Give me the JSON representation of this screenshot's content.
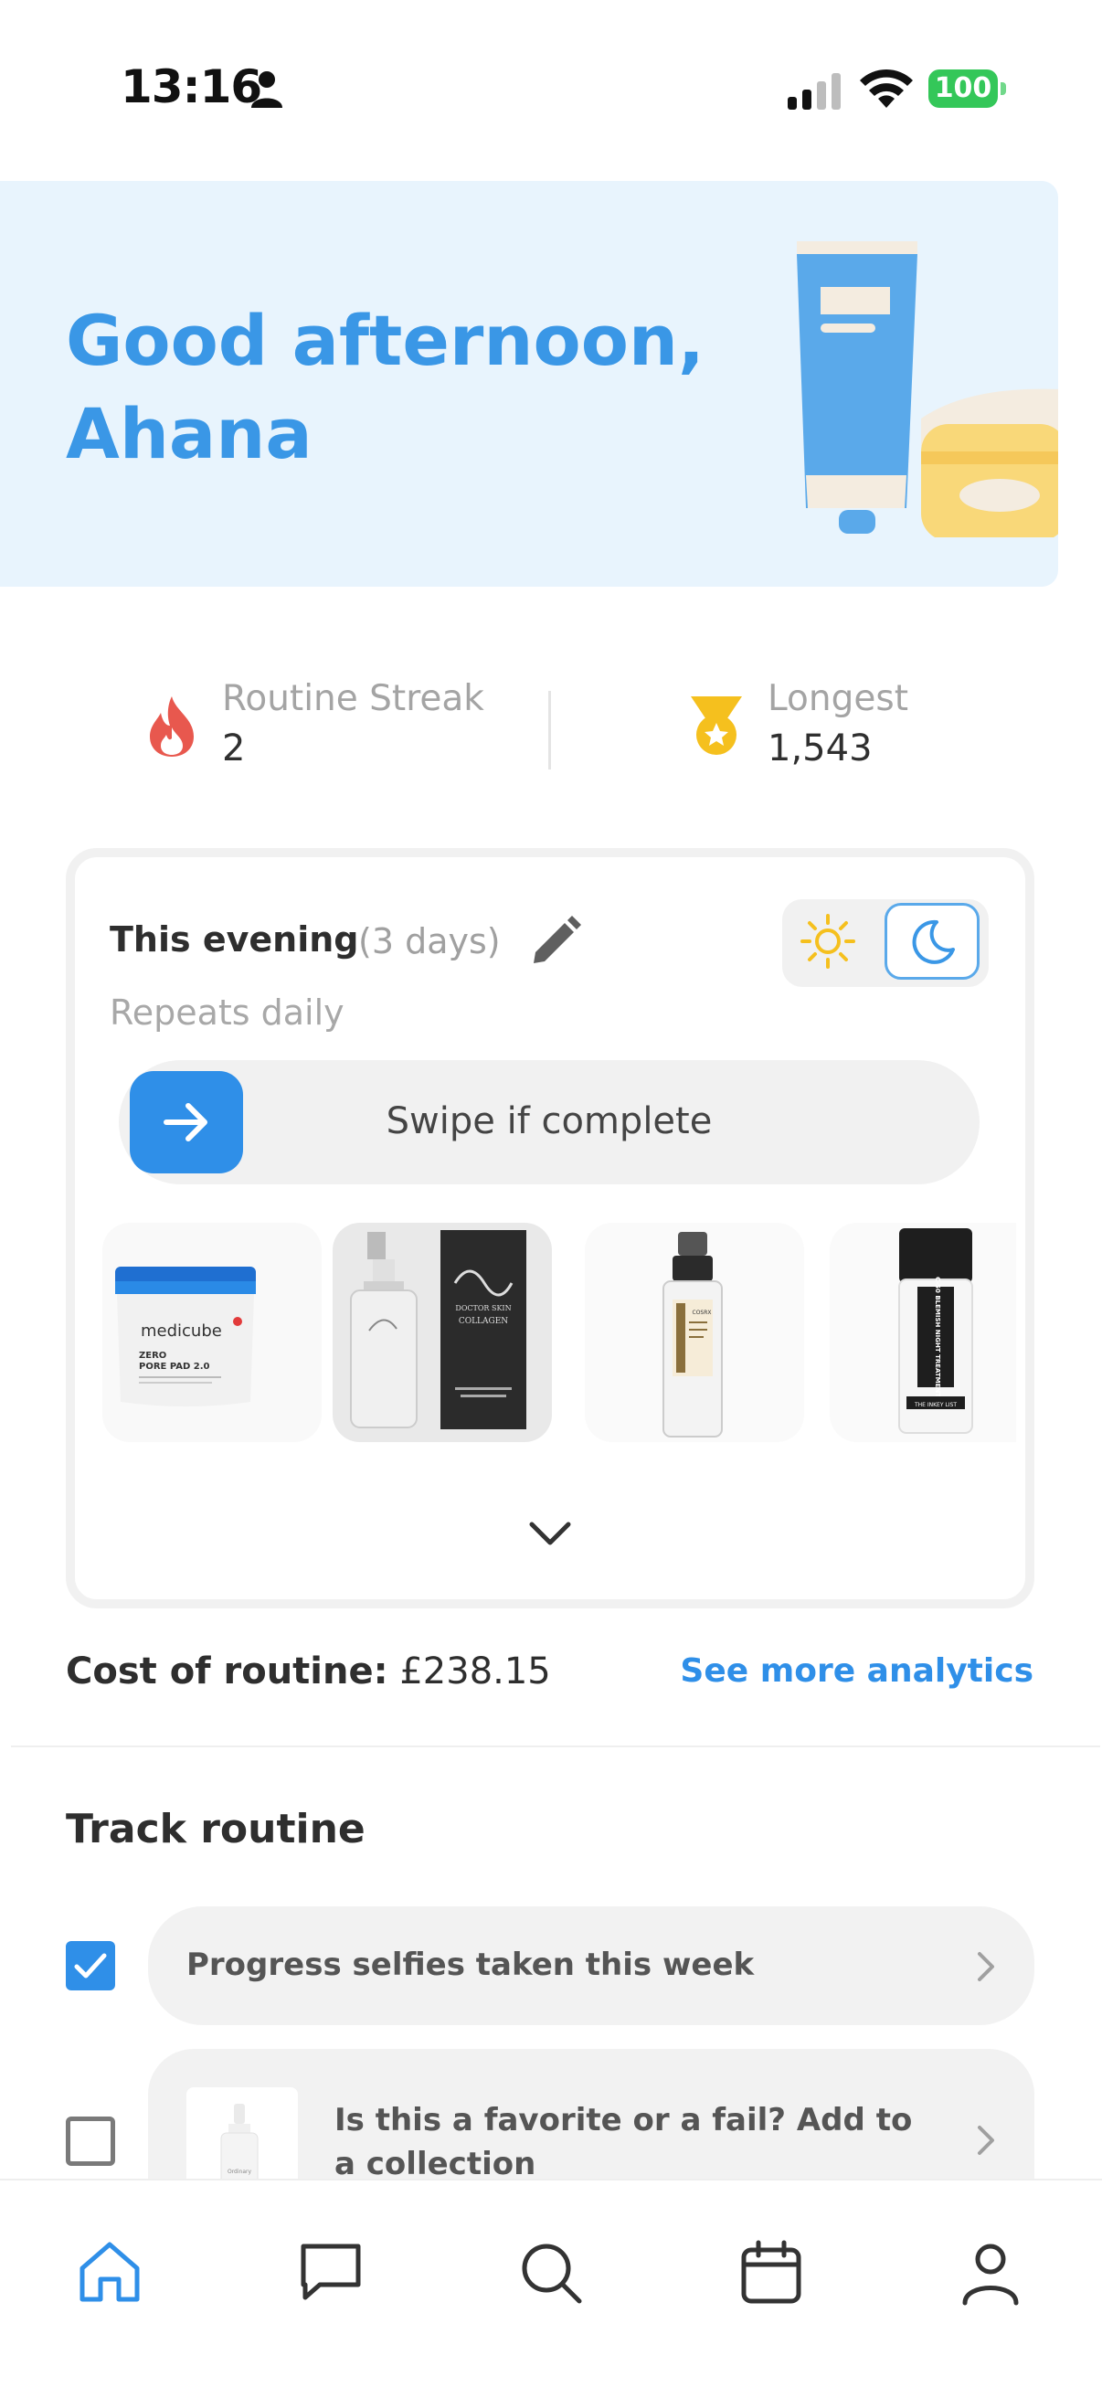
{
  "status_bar": {
    "time": "13:16",
    "battery": "100",
    "icons": [
      "person-icon",
      "signal-icon",
      "wifi-icon",
      "battery-icon"
    ]
  },
  "hero": {
    "greeting": "Good afternoon, Ahana",
    "background_color": "#e8f4fd",
    "text_color": "#3a97e6"
  },
  "stats": {
    "streak": {
      "label": "Routine Streak",
      "value": "2",
      "icon": "flame-icon"
    },
    "longest": {
      "label": "Longest",
      "value": "1,543",
      "icon": "medal-icon"
    }
  },
  "routine": {
    "title": "This evening",
    "days": "(3 days)",
    "repeats": "Repeats daily",
    "toggle_selected": "evening",
    "swipe_label": "Swipe if complete",
    "products": [
      "medicube-zero-pore-pad",
      "doctor-skin-collagen-serum",
      "cosrx-snail-essence",
      "inkey-c50-blemish-treatment"
    ],
    "product_texts": {
      "p1_brand": "medicube",
      "p1_line1": "ZERO",
      "p1_line2": "PORE PAD 2.0",
      "p2_brand": "DOCTOR SKIN",
      "p2_name": "COLLAGEN",
      "p3_brand": "COSRX",
      "p4_name": "C-50 BLEMISH NIGHT TREATMENT",
      "p4_brand": "THE INKEY LIST"
    }
  },
  "cost": {
    "label": "Cost of routine:",
    "value": "£238.15",
    "analytics_link": "See more analytics"
  },
  "track": {
    "title": "Track routine",
    "items": [
      {
        "label": "Progress selfies taken this week",
        "checked": true
      },
      {
        "label": "Is this a favorite or a fail? Add to a collection",
        "checked": false
      }
    ],
    "thumb_text": "Ordinary"
  },
  "tab_bar": {
    "items": [
      "home-icon",
      "chat-icon",
      "search-icon",
      "calendar-icon",
      "profile-icon"
    ],
    "active": "home-icon"
  },
  "colors": {
    "accent": "#2f8fe8",
    "flame": "#e8584e",
    "medal": "#f5c01e"
  }
}
